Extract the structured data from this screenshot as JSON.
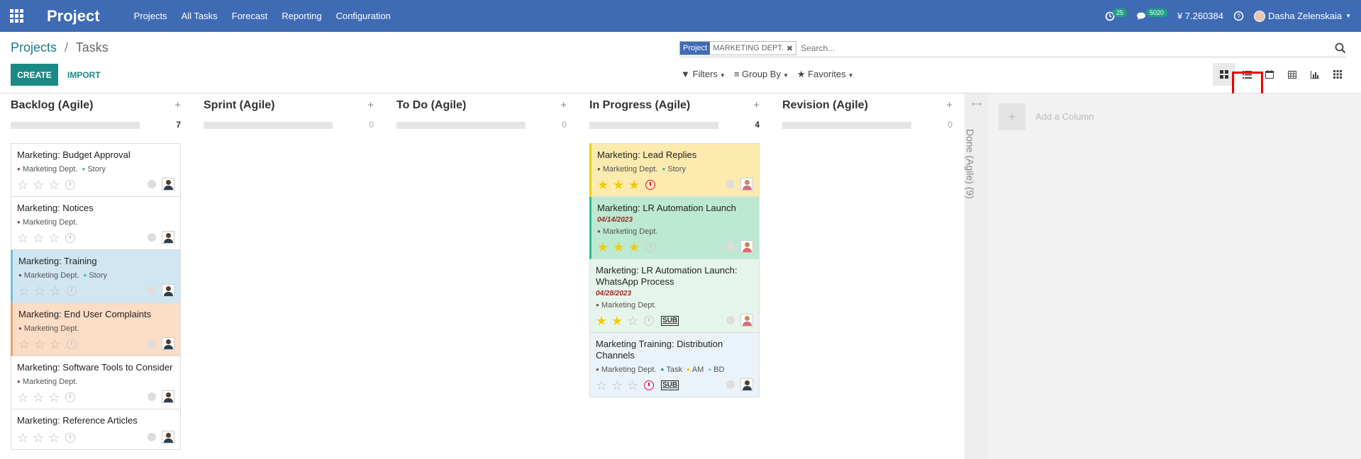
{
  "topbar": {
    "app_title": "Project",
    "menu": [
      "Projects",
      "All Tasks",
      "Forecast",
      "Reporting",
      "Configuration"
    ],
    "activity_count": "25",
    "messages_count": "5020",
    "currency_value": "¥ 7.260384",
    "user_name": "Dasha Zelenskaia"
  },
  "breadcrumb": {
    "parent": "Projects",
    "separator": "/",
    "current": "Tasks"
  },
  "actions": {
    "create": "CREATE",
    "import": "IMPORT"
  },
  "search": {
    "facet_label": "Project",
    "facet_value": "MARKETING DEPT.",
    "placeholder": "Search..."
  },
  "filters": {
    "filters": "Filters",
    "group_by": "Group By",
    "favorites": "Favorites"
  },
  "columns": [
    {
      "name": "Backlog (Agile)",
      "count": "7",
      "cards": [
        {
          "title": "Marketing: Budget Approval",
          "tags": [
            {
              "label": "Marketing Dept.",
              "c": "c-proj"
            },
            {
              "label": "Story",
              "c": "c-green"
            }
          ],
          "stars": 0
        },
        {
          "title": "Marketing: Notices",
          "tags": [
            {
              "label": "Marketing Dept.",
              "c": "c-proj"
            }
          ],
          "stars": 0
        },
        {
          "title": "Marketing: Training",
          "tags": [
            {
              "label": "Marketing Dept.",
              "c": "c-proj"
            },
            {
              "label": "Story",
              "c": "c-green"
            }
          ],
          "stars": 0
        },
        {
          "title": "Marketing: End User Complaints",
          "tags": [
            {
              "label": "Marketing Dept.",
              "c": "c-proj"
            }
          ],
          "stars": 0
        },
        {
          "title": "Marketing: Software Tools to Consider",
          "tags": [
            {
              "label": "Marketing Dept.",
              "c": "c-proj"
            }
          ],
          "stars": 0
        },
        {
          "title": "Marketing: Reference Articles",
          "tags": [],
          "stars": 0
        }
      ]
    },
    {
      "name": "Sprint (Agile)",
      "count": "0",
      "cards": []
    },
    {
      "name": "To Do (Agile)",
      "count": "0",
      "cards": []
    },
    {
      "name": "In Progress (Agile)",
      "count": "4",
      "cards": [
        {
          "title": "Marketing: Lead Replies",
          "tags": [
            {
              "label": "Marketing Dept.",
              "c": "c-proj"
            },
            {
              "label": "Story",
              "c": "c-green"
            }
          ],
          "stars": 3
        },
        {
          "title": "Marketing: LR Automation Launch",
          "date": "04/14/2023",
          "tags": [
            {
              "label": "Marketing Dept.",
              "c": "c-proj"
            }
          ],
          "stars": 3
        },
        {
          "title": "Marketing: LR Automation Launch: WhatsApp Process",
          "date": "04/28/2023",
          "tags": [
            {
              "label": "Marketing Dept.",
              "c": "c-proj"
            }
          ],
          "stars": 2,
          "sub": "SUB"
        },
        {
          "title": "Marketing Training: Distribution Channels",
          "tags": [
            {
              "label": "Marketing Dept.",
              "c": "c-proj"
            },
            {
              "label": "Task",
              "c": "c-teal"
            },
            {
              "label": "AM",
              "c": "c-yellow"
            },
            {
              "label": "BD",
              "c": "c-blue"
            }
          ],
          "stars": 0,
          "sub": "SUB"
        }
      ]
    },
    {
      "name": "Revision (Agile)",
      "count": "0",
      "cards": []
    }
  ],
  "folded_column": {
    "label": "Done (Agile) (9)"
  },
  "add_column": {
    "label": "Add a Column",
    "plus": "+"
  },
  "colors": {
    "topbar": "#3f6bb5",
    "primary": "#1b8a86",
    "star": "#f3cc00"
  }
}
